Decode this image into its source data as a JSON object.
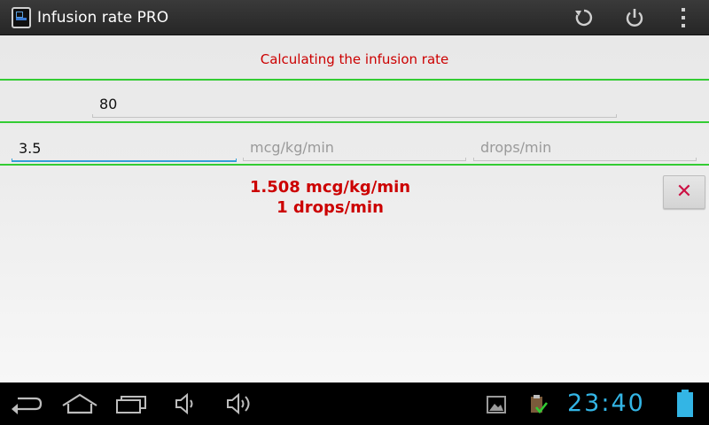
{
  "app": {
    "title": "Infusion rate PRO"
  },
  "content": {
    "header": "Calculating the infusion rate",
    "weight_value": "80",
    "dose_value": "3.5",
    "rate_placeholder": "mcg/kg/min",
    "drops_placeholder": "drops/min",
    "result_line1": "1.508 mcg/kg/min",
    "result_line2": "1 drops/min",
    "clear_label": "✕"
  },
  "system": {
    "clock": "23:40"
  },
  "colors": {
    "accent_red": "#cc0000",
    "divider_green": "#33cc33",
    "focus_blue": "#33a0d8",
    "clock_blue": "#33b5e5"
  }
}
